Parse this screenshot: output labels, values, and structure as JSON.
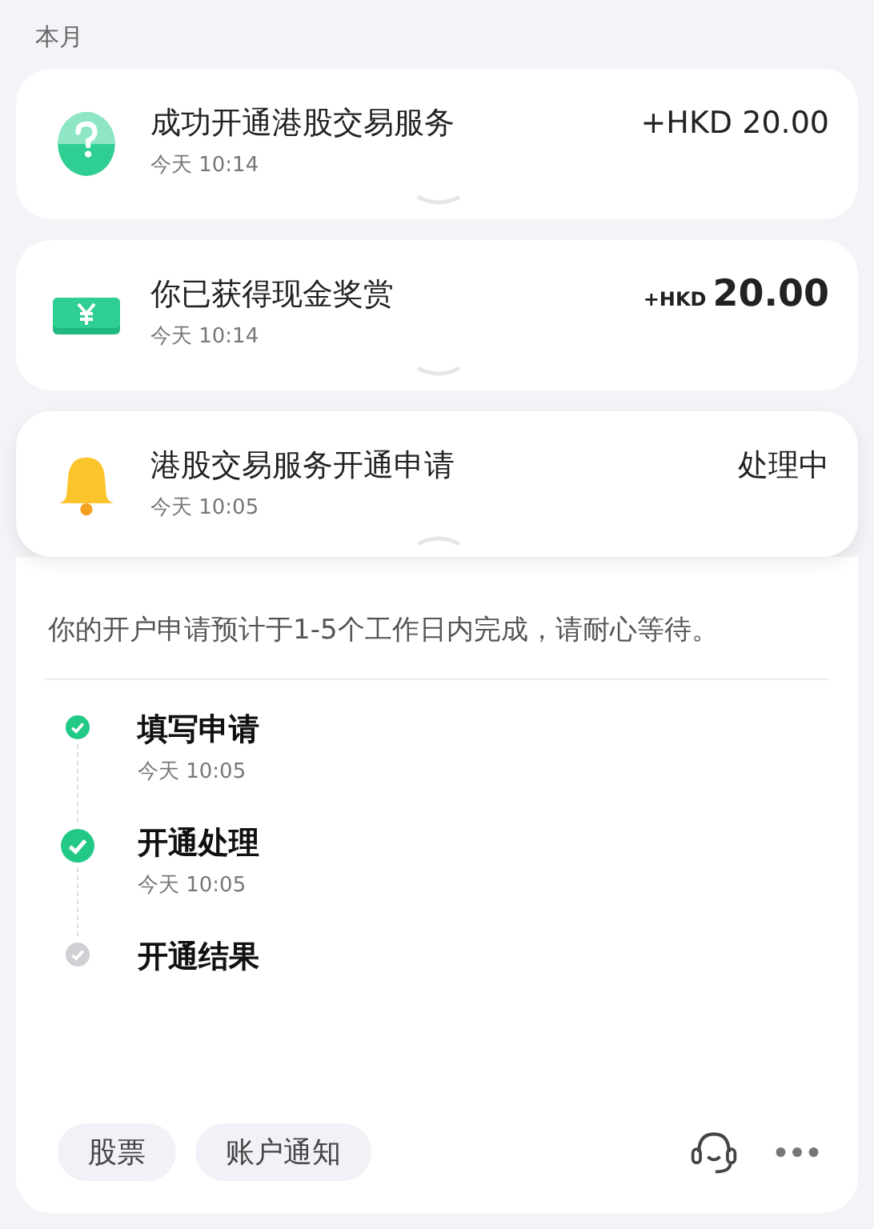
{
  "section_title": "本月",
  "items": [
    {
      "kind": "help",
      "title": "成功开通港股交易服务",
      "time": "今天 10:14",
      "amount": "+HKD 20.00",
      "expanded": false
    },
    {
      "kind": "cash",
      "title": "你已获得现金奖赏",
      "time": "今天 10:14",
      "amount_prefix": "+HKD",
      "amount": "20.00",
      "expanded": false
    },
    {
      "kind": "bell",
      "title": "港股交易服务开通申请",
      "time": "今天 10:05",
      "status": "处理中",
      "expanded": true
    }
  ],
  "detail": {
    "message": "你的开户申请预计于1-5个工作日内完成，请耐心等待。",
    "steps": [
      {
        "title": "填写申请",
        "time": "今天 10:05",
        "done": true,
        "current": false
      },
      {
        "title": "开通处理",
        "time": "今天 10:05",
        "done": true,
        "current": true
      },
      {
        "title": "开通结果",
        "done": false,
        "current": false
      }
    ],
    "tags": [
      "股票",
      "账户通知"
    ]
  }
}
